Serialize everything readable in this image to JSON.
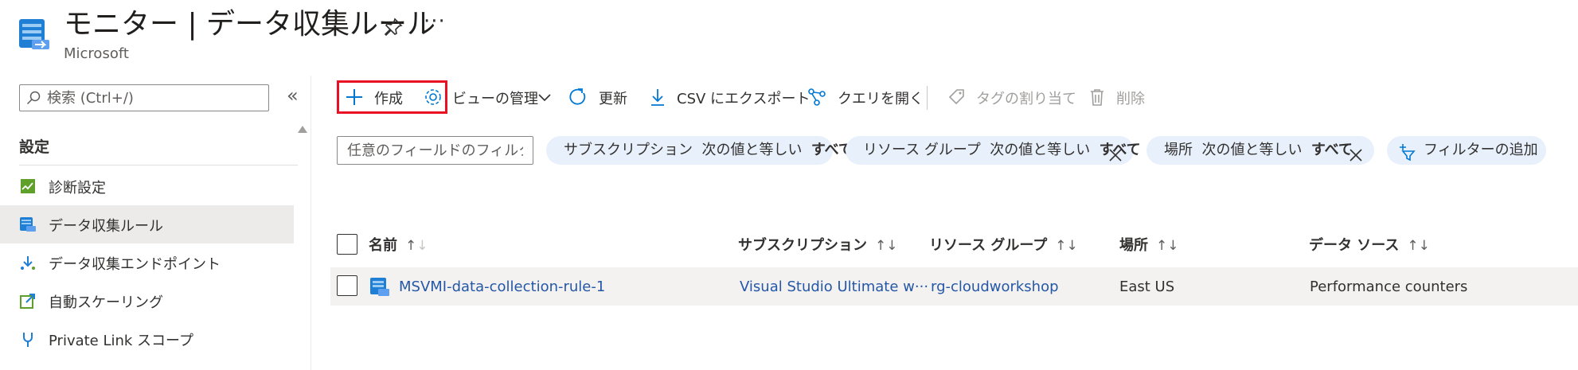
{
  "header": {
    "title": "モニター | データ収集ルール",
    "subtitle": "Microsoft",
    "more_label": "···"
  },
  "sidebar": {
    "search_placeholder": "検索 (Ctrl+/)",
    "collapse_label": "«",
    "section_title": "設定",
    "items": [
      {
        "label": "診断設定",
        "icon": "diagnostic-settings-icon"
      },
      {
        "label": "データ収集ルール",
        "icon": "data-collection-rule-icon",
        "selected": true
      },
      {
        "label": "データ収集エンドポイント",
        "icon": "data-collection-endpoint-icon"
      },
      {
        "label": "自動スケーリング",
        "icon": "autoscale-icon"
      },
      {
        "label": "Private Link スコープ",
        "icon": "private-link-icon"
      }
    ]
  },
  "toolbar": {
    "create": "作成",
    "manage_view": "ビューの管理",
    "refresh": "更新",
    "export_csv": "CSV にエクスポート",
    "open_query": "クエリを開く",
    "assign_tags": "タグの割り当て",
    "delete": "削除"
  },
  "filters": {
    "placeholder": "任意のフィールドのフィルター...",
    "pills": [
      {
        "field": "サブスクリプション",
        "op": "次の値と等しい",
        "value": "すべて",
        "removable": false
      },
      {
        "field": "リソース グループ",
        "op": "次の値と等しい",
        "value": "すべて",
        "removable": true
      },
      {
        "field": "場所",
        "op": "次の値と等しい",
        "value": "すべて",
        "removable": true
      }
    ],
    "add_filter": "フィルターの追加"
  },
  "table": {
    "columns": [
      "名前",
      "サブスクリプション",
      "リソース グループ",
      "場所",
      "データ ソース"
    ],
    "sort_glyph_up": "↑",
    "sort_glyph_down": "↓",
    "rows": [
      {
        "name": "MSVMI-data-collection-rule-1",
        "subscription": "Visual Studio Ultimate w···",
        "resource_group": "rg-cloudworkshop",
        "location": "East US",
        "data_source": "Performance counters"
      }
    ]
  },
  "colors": {
    "accent": "#0078d4",
    "link": "#2557a7",
    "highlight_border": "#e81123",
    "pill_bg": "#e8f0fb",
    "selected_bg": "#edebe9"
  }
}
